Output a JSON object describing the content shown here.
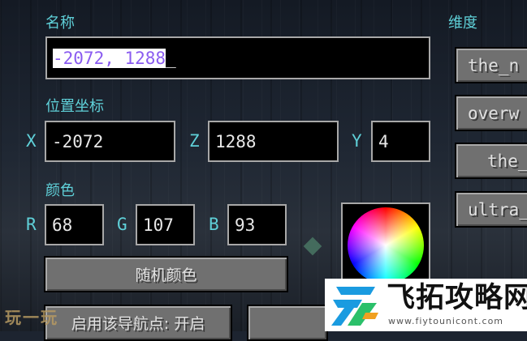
{
  "name_section": {
    "label": "名称",
    "value_selected": "-2072, 1288",
    "cursor": "_"
  },
  "position_section": {
    "label": "位置坐标",
    "x_label": "X",
    "x_value": "-2072",
    "z_label": "Z",
    "z_value": "1288",
    "y_label": "Y",
    "y_value": "4"
  },
  "color_section": {
    "label": "颜色",
    "r_label": "R",
    "r_value": "68",
    "g_label": "G",
    "g_value": "107",
    "b_label": "B",
    "b_value": "93",
    "random_button": "随机颜色",
    "swatch_color": "#446B5D"
  },
  "waypoint_toggle_button": "启用该导航点: 开启",
  "dimension_section": {
    "label": "维度",
    "items": [
      "the_n",
      "overw",
      "the_",
      "ultra_"
    ]
  },
  "watermark": {
    "title": "飞拓攻略网",
    "url": "www.fiytounicont.com",
    "bottom_left": "玩一玩"
  },
  "colors": {
    "accent": "#5fd0d8",
    "selection_text": "#8a5cf0",
    "button": "#707070"
  }
}
